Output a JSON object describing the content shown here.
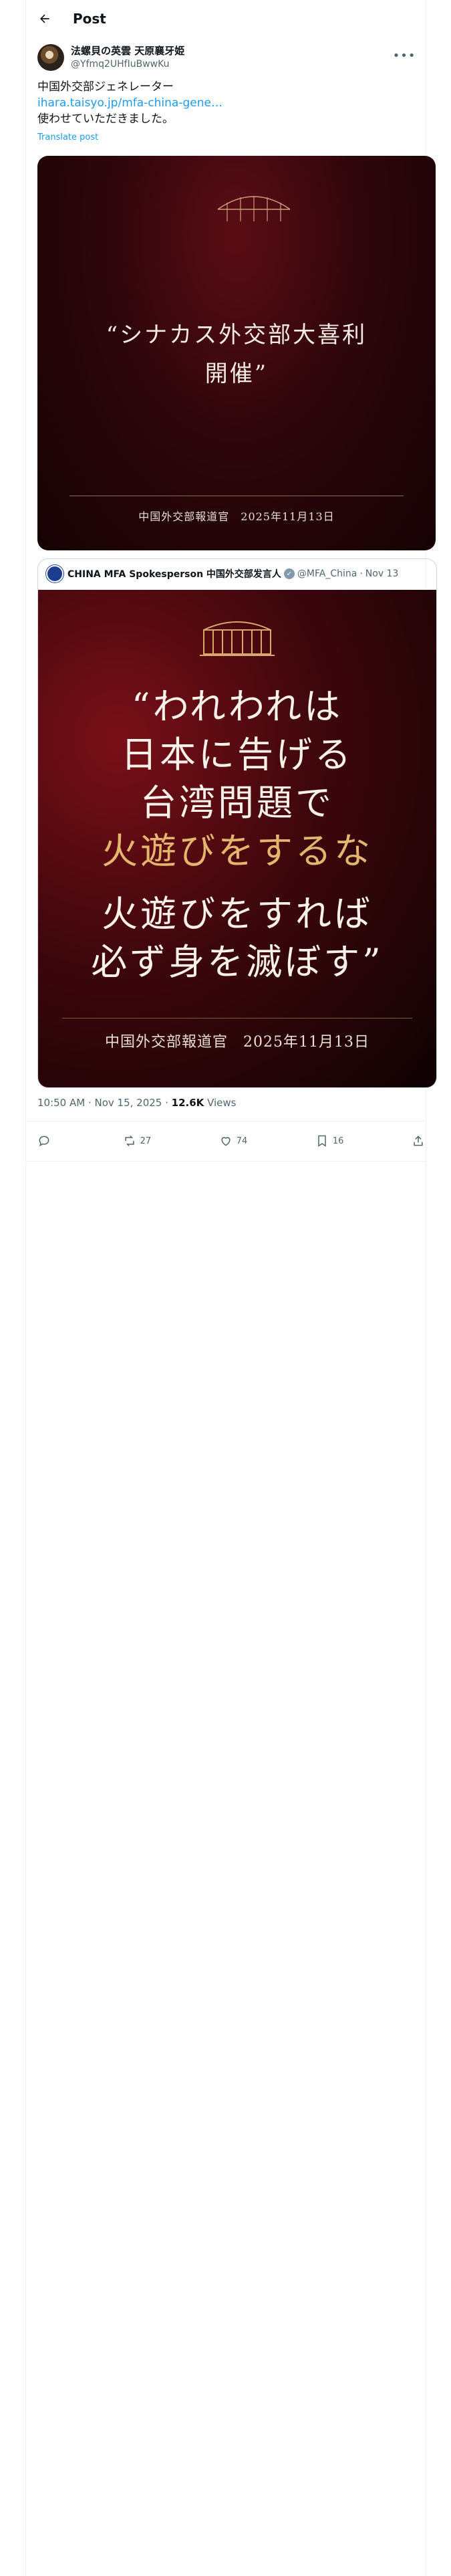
{
  "header": {
    "title": "Post"
  },
  "author": {
    "display_name": "法螺貝の英雲 天原襄牙姫",
    "handle": "@Yfmq2UHfIuBwwKu"
  },
  "tweet": {
    "line1": "中国外交部ジェネレーター",
    "link": "ihara.taisyo.jp/mfa-china-gene…",
    "line3": "使わせていただきました。",
    "translate": "Translate post"
  },
  "image1": {
    "quote_line1": "“シナカス外交部大喜利",
    "quote_line2": "開催”",
    "footer": "中国外交部報道官　2025年11月13日"
  },
  "quoted_post": {
    "display_name": "CHINA MFA Spokesperson 中国外交部发言人",
    "handle": "@MFA_China",
    "separator": "·",
    "date": "Nov 13",
    "image_lines": [
      "“われわれは",
      "日本に告げる",
      "台湾問題で",
      "火遊びをするな",
      "火遊びをすれば",
      "必ず身を滅ぼす”"
    ],
    "footer": "中国外交部報道官　2025年11月13日"
  },
  "post_meta": {
    "time": "10:50 AM · Nov 15, 2025 · ",
    "views_count": "12.6K",
    "views_label": " Views"
  },
  "actions": {
    "reply_count": "",
    "repost_count": "27",
    "like_count": "74",
    "bookmark_count": "16"
  },
  "colors": {
    "accent": "#1d9bf0",
    "gold_text": "#e4b66d"
  },
  "icons": [
    "back-arrow-icon",
    "more-icon",
    "verified-icon",
    "reply-icon",
    "repost-icon",
    "like-icon",
    "bookmark-icon",
    "share-icon"
  ]
}
